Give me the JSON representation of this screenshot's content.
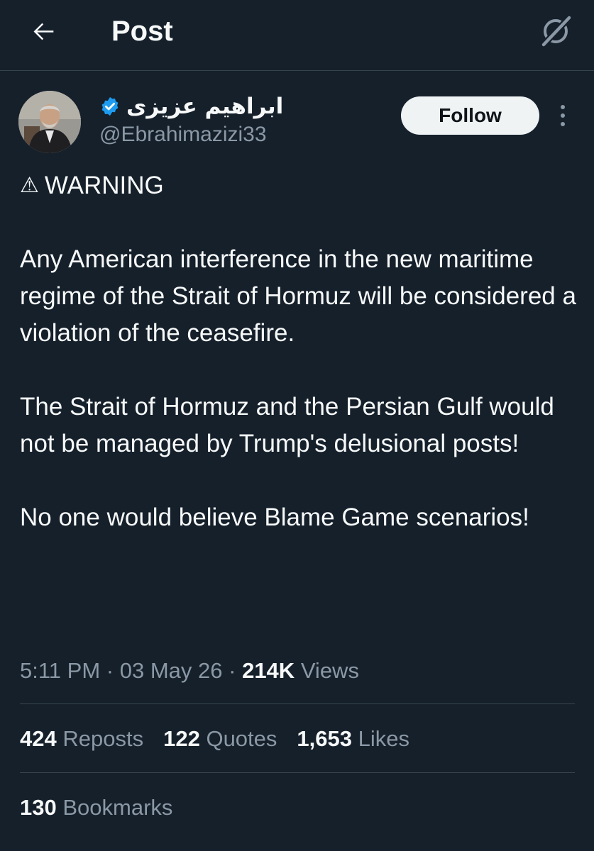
{
  "header": {
    "title": "Post",
    "back_icon": "arrow-left-icon",
    "grok_icon": "grok-icon"
  },
  "author": {
    "display_name": "ابراهیم عزیزی",
    "handle": "@Ebrahimazizi33",
    "verified": true,
    "verified_color": "#1d9bf0"
  },
  "actions": {
    "follow_label": "Follow",
    "more_icon": "more-vertical-icon"
  },
  "post": {
    "warning_symbol": "⚠",
    "warning_text": "WARNING",
    "paragraphs": [
      "Any American interference in the new maritime regime of the Strait of Hormuz will be considered a violation of the ceasefire.",
      "The Strait of Hormuz and the Persian Gulf would not be managed by Trump's delusional posts!",
      "No one would believe Blame Game scenarios!"
    ],
    "time": "5:11 PM",
    "separator": "·",
    "date": "03 May 26",
    "views_count": "214K",
    "views_label": "Views"
  },
  "stats": {
    "reposts_count": "424",
    "reposts_label": "Reposts",
    "quotes_count": "122",
    "quotes_label": "Quotes",
    "likes_count": "1,653",
    "likes_label": "Likes",
    "bookmarks_count": "130",
    "bookmarks_label": "Bookmarks"
  },
  "colors": {
    "background": "#15202b",
    "text_primary": "#f7f9f9",
    "text_secondary": "#8b98a5",
    "divider": "#38444d",
    "follow_bg": "#eff3f4"
  }
}
